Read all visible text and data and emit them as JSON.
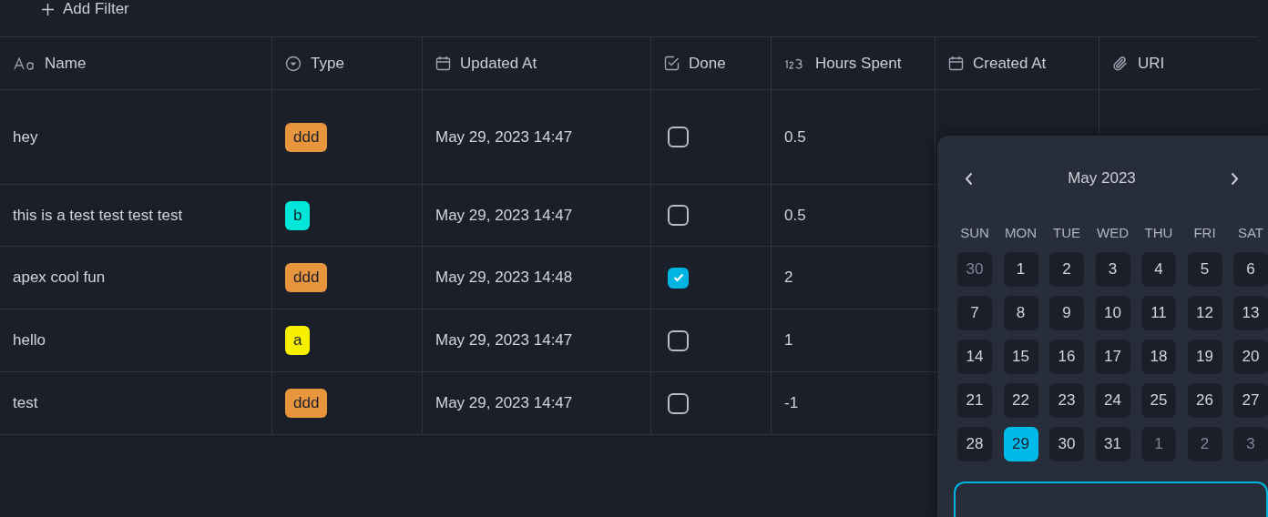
{
  "toolbar": {
    "add_filter": "Add Filter"
  },
  "table": {
    "columns": [
      {
        "label": "Name",
        "kind": "text"
      },
      {
        "label": "Type",
        "kind": "select"
      },
      {
        "label": "Updated At",
        "kind": "date"
      },
      {
        "label": "Done",
        "kind": "checkbox"
      },
      {
        "label": "Hours Spent",
        "kind": "number"
      },
      {
        "label": "Created At",
        "kind": "date"
      },
      {
        "label": "URI",
        "kind": "url"
      }
    ],
    "rows": [
      {
        "name": "hey",
        "type": {
          "label": "ddd",
          "color": "#e8963e"
        },
        "updated_at": "May 29, 2023 14:47",
        "done": false,
        "hours": "0.5"
      },
      {
        "name": "this is a test test test test",
        "type": {
          "label": "b",
          "color": "#00e6d8"
        },
        "updated_at": "May 29, 2023 14:47",
        "done": false,
        "hours": "0.5"
      },
      {
        "name": "apex cool fun",
        "type": {
          "label": "ddd",
          "color": "#e8963e"
        },
        "updated_at": "May 29, 2023 14:48",
        "done": true,
        "hours": "2"
      },
      {
        "name": "hello",
        "type": {
          "label": "a",
          "color": "#f7ef00"
        },
        "updated_at": "May 29, 2023 14:47",
        "done": false,
        "hours": "1"
      },
      {
        "name": "test",
        "type": {
          "label": "ddd",
          "color": "#e8963e"
        },
        "updated_at": "May 29, 2023 14:47",
        "done": false,
        "hours": "-1"
      }
    ]
  },
  "date_picker": {
    "month": "May 2023",
    "weekdays": [
      "SUN",
      "MON",
      "TUE",
      "WED",
      "THU",
      "FRI",
      "SAT"
    ],
    "days": [
      {
        "label": "30",
        "outside": true,
        "selected": false
      },
      {
        "label": "1",
        "outside": false,
        "selected": false
      },
      {
        "label": "2",
        "outside": false,
        "selected": false
      },
      {
        "label": "3",
        "outside": false,
        "selected": false
      },
      {
        "label": "4",
        "outside": false,
        "selected": false
      },
      {
        "label": "5",
        "outside": false,
        "selected": false
      },
      {
        "label": "6",
        "outside": false,
        "selected": false
      },
      {
        "label": "7",
        "outside": false,
        "selected": false
      },
      {
        "label": "8",
        "outside": false,
        "selected": false
      },
      {
        "label": "9",
        "outside": false,
        "selected": false
      },
      {
        "label": "10",
        "outside": false,
        "selected": false
      },
      {
        "label": "11",
        "outside": false,
        "selected": false
      },
      {
        "label": "12",
        "outside": false,
        "selected": false
      },
      {
        "label": "13",
        "outside": false,
        "selected": false
      },
      {
        "label": "14",
        "outside": false,
        "selected": false
      },
      {
        "label": "15",
        "outside": false,
        "selected": false
      },
      {
        "label": "16",
        "outside": false,
        "selected": false
      },
      {
        "label": "17",
        "outside": false,
        "selected": false
      },
      {
        "label": "18",
        "outside": false,
        "selected": false
      },
      {
        "label": "19",
        "outside": false,
        "selected": false
      },
      {
        "label": "20",
        "outside": false,
        "selected": false
      },
      {
        "label": "21",
        "outside": false,
        "selected": false
      },
      {
        "label": "22",
        "outside": false,
        "selected": false
      },
      {
        "label": "23",
        "outside": false,
        "selected": false
      },
      {
        "label": "24",
        "outside": false,
        "selected": false
      },
      {
        "label": "25",
        "outside": false,
        "selected": false
      },
      {
        "label": "26",
        "outside": false,
        "selected": false
      },
      {
        "label": "27",
        "outside": false,
        "selected": false
      },
      {
        "label": "28",
        "outside": false,
        "selected": false
      },
      {
        "label": "29",
        "outside": false,
        "selected": true
      },
      {
        "label": "30",
        "outside": false,
        "selected": false
      },
      {
        "label": "31",
        "outside": false,
        "selected": false
      },
      {
        "label": "1",
        "outside": true,
        "selected": false
      },
      {
        "label": "2",
        "outside": true,
        "selected": false
      },
      {
        "label": "3",
        "outside": true,
        "selected": false
      }
    ]
  }
}
